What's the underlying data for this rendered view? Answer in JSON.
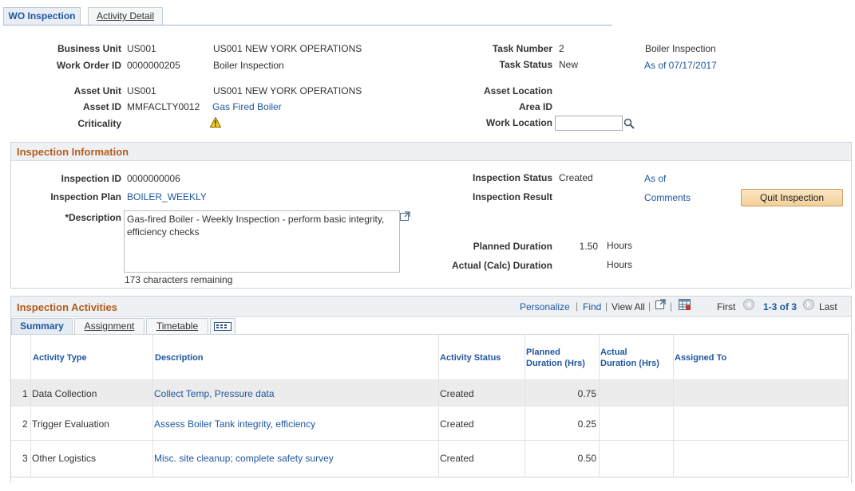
{
  "tabs": [
    {
      "label": "WO Inspection"
    },
    {
      "label": "Activity Detail"
    }
  ],
  "header": {
    "business_unit": {
      "label": "Business Unit",
      "code": "US001",
      "name": "US001 NEW YORK OPERATIONS"
    },
    "work_order": {
      "label": "Work Order ID",
      "id": "0000000205",
      "name": "Boiler Inspection"
    },
    "task_number": {
      "label": "Task Number",
      "value": "2",
      "name": "Boiler Inspection"
    },
    "task_status": {
      "label": "Task Status",
      "value": "New",
      "as_of": "As of 07/17/2017"
    },
    "asset_unit": {
      "label": "Asset Unit",
      "code": "US001",
      "name": "US001 NEW YORK OPERATIONS"
    },
    "asset_id": {
      "label": "Asset ID",
      "value": "MMFACLTY0012",
      "name": "Gas Fired Boiler"
    },
    "criticality": {
      "label": "Criticality",
      "icon": "warning-icon"
    },
    "asset_location": {
      "label": "Asset Location"
    },
    "area_id": {
      "label": "Area ID"
    },
    "work_location": {
      "label": "Work Location",
      "value": "",
      "icon": "search-icon"
    }
  },
  "inspection_info": {
    "title": "Inspection Information",
    "inspection_id": {
      "label": "Inspection ID",
      "value": "0000000006"
    },
    "inspection_plan": {
      "label": "Inspection Plan",
      "value": "BOILER_WEEKLY"
    },
    "description": {
      "label": "*Description",
      "value": "Gas-fired Boiler - Weekly Inspection - perform basic integrity, efficiency checks",
      "remaining": "173 characters remaining"
    },
    "inspection_status": {
      "label": "Inspection Status",
      "value": "Created",
      "as_of": "As of"
    },
    "inspection_result": {
      "label": "Inspection Result",
      "comments": "Comments"
    },
    "quit_button": "Quit Inspection",
    "planned_duration": {
      "label": "Planned Duration",
      "value": "1.50",
      "unit": "Hours"
    },
    "actual_duration": {
      "label": "Actual (Calc) Duration",
      "value": "",
      "unit": "Hours"
    }
  },
  "activities": {
    "title": "Inspection Activities",
    "toolbar": {
      "personalize": "Personalize",
      "find": "Find",
      "view_all": "View All",
      "first": "First",
      "range": "1-3 of 3",
      "last": "Last"
    },
    "grid_tabs": [
      {
        "label": "Summary"
      },
      {
        "label": "Assignment"
      },
      {
        "label": "Timetable"
      }
    ],
    "columns": [
      "Activity Type",
      "Description",
      "Activity Status",
      "Planned Duration (Hrs)",
      "Actual Duration (Hrs)",
      "Assigned To"
    ],
    "column_lines": {
      "planned": [
        "Planned",
        "Duration (Hrs)"
      ],
      "actual": [
        "Actual",
        "Duration (Hrs)"
      ]
    },
    "rows": [
      {
        "num": "1",
        "type": "Data Collection",
        "description": "Collect Temp, Pressure data",
        "status": "Created",
        "planned": "0.75",
        "actual": "",
        "assigned": ""
      },
      {
        "num": "2",
        "type": "Trigger Evaluation",
        "description": "Assess Boiler Tank integrity, efficiency",
        "status": "Created",
        "planned": "0.25",
        "actual": "",
        "assigned": ""
      },
      {
        "num": "3",
        "type": "Other Logistics",
        "description": "Misc. site cleanup; complete safety survey",
        "status": "Created",
        "planned": "0.50",
        "actual": "",
        "assigned": ""
      }
    ]
  }
}
